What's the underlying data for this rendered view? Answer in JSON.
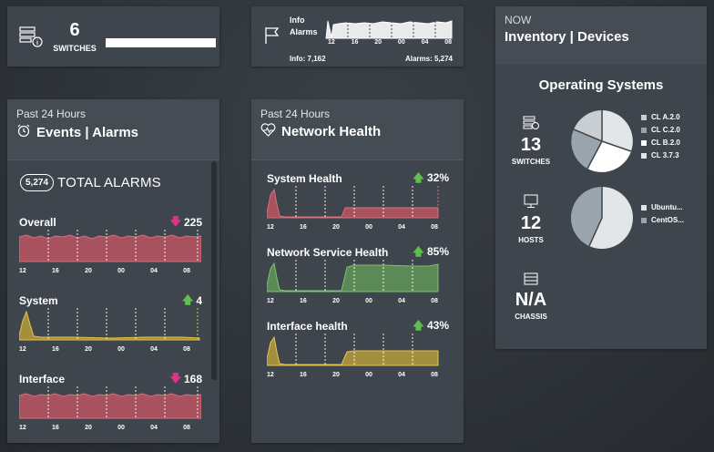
{
  "switches_card": {
    "count": "6",
    "label": "SWITCHES"
  },
  "info_card": {
    "label_info": "Info",
    "label_alarms": "Alarms",
    "ticks": [
      "12",
      "16",
      "20",
      "00",
      "04",
      "08"
    ],
    "info_count": "Info: 7,162",
    "alarm_count": "Alarms: 5,274"
  },
  "inventory": {
    "now": "NOW",
    "title": "Inventory | Devices",
    "os_title": "Operating Systems",
    "switches": {
      "count": "13",
      "label": "SWITCHES"
    },
    "hosts": {
      "count": "12",
      "label": "HOSTS"
    },
    "chassis": {
      "count": "N/A",
      "label": "CHASSIS"
    },
    "switch_os_legend": [
      {
        "label": "CL A.2.0",
        "color": "#c9ced3"
      },
      {
        "label": "CL C.2.0",
        "color": "#9aa4ad"
      },
      {
        "label": "CL B.2.0",
        "color": "#ffffff"
      },
      {
        "label": "CL 3.7.3",
        "color": "#e3e6e9"
      }
    ],
    "host_os_legend": [
      {
        "label": "Ubuntu...",
        "color": "#e3e6e9"
      },
      {
        "label": "CentOS...",
        "color": "#9aa4ad"
      }
    ]
  },
  "events": {
    "period": "Past 24 Hours",
    "title": "Events | Alarms",
    "total_count": "5,274",
    "total_label": "TOTAL ALARMS",
    "ticks": [
      "12",
      "16",
      "20",
      "00",
      "04",
      "08"
    ],
    "rows": [
      {
        "label": "Overall",
        "value": "225",
        "trend": "down"
      },
      {
        "label": "System",
        "value": "4",
        "trend": "up"
      },
      {
        "label": "Interface",
        "value": "168",
        "trend": "down"
      }
    ]
  },
  "network": {
    "period": "Past 24 Hours",
    "title": "Network Health",
    "ticks": [
      "12",
      "16",
      "20",
      "00",
      "04",
      "08"
    ],
    "rows": [
      {
        "label": "System Health",
        "value": "32%",
        "trend": "up"
      },
      {
        "label": "Network Service Health",
        "value": "85%",
        "trend": "up"
      },
      {
        "label": "Interface health",
        "value": "43%",
        "trend": "up"
      }
    ]
  },
  "colors": {
    "red_fill": "#a8525f",
    "red_line": "#d9707e",
    "yellow_fill": "#a48f3e",
    "yellow_line": "#e5c44d",
    "green_fill": "#5c8a57",
    "green_line": "#7fc072",
    "arrow_down": "#e0308a",
    "arrow_up": "#5fbf4e"
  }
}
